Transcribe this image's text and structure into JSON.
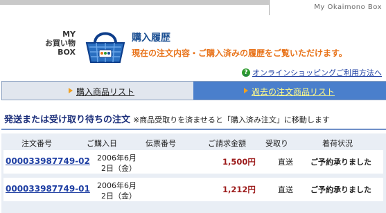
{
  "top_bar": {
    "site_label": "My Okaimono Box"
  },
  "logo": {
    "line1": "MY",
    "line2": "お買い物",
    "line3": "BOX"
  },
  "basket_icon": "shopping-basket-icon",
  "page": {
    "title": "購入履歴",
    "subtitle": "現在の注文内容・ご購入済みの履歴をご覧いただけます。"
  },
  "help_link": {
    "icon": "help-icon",
    "label": "オンラインショッピングご利用方法へ"
  },
  "tabs": [
    {
      "label": "購入商品リスト",
      "active": false
    },
    {
      "label": "過去の注文商品リスト",
      "active": true
    }
  ],
  "section": {
    "heading": "発送または受け取り待ちの注文",
    "note": "※商品受取りを済ませると「購入済み注文」に移動します"
  },
  "table": {
    "headers": {
      "order_no": "注文番号",
      "purchase_date": "ご購入日",
      "slip_no": "伝票番号",
      "amount": "ご請求金額",
      "delivery": "受取り",
      "status": "着荷状況"
    },
    "rows": [
      {
        "order_no": "000033987749-02",
        "date_line1": "2006年6月",
        "date_line2": "2日（金）",
        "slip_no": "",
        "amount": "1,500円",
        "delivery": "直送",
        "status": "ご予約承りました"
      },
      {
        "order_no": "000033987749-01",
        "date_line1": "2006年6月",
        "date_line2": "2日（金）",
        "slip_no": "",
        "amount": "1,212円",
        "delivery": "直送",
        "status": "ご予約承りました"
      }
    ]
  },
  "colors": {
    "title_blue": "#1b4f92",
    "subtitle_orange": "#e8731a",
    "active_tab": "#4a7fcc",
    "amount_red": "#9c1b1b"
  }
}
